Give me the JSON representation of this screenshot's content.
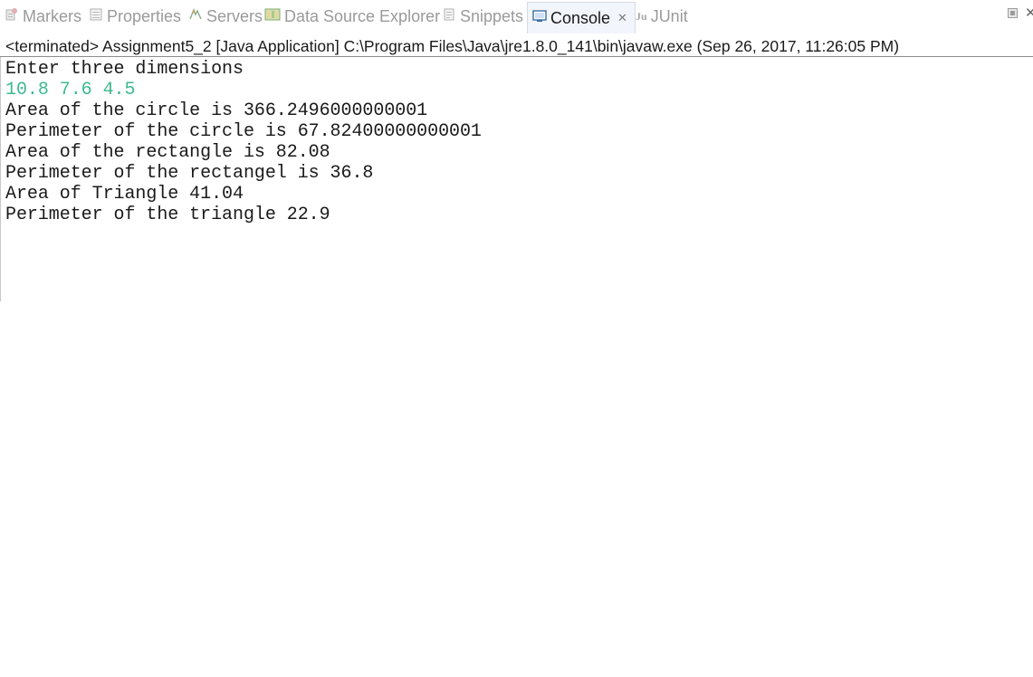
{
  "tabs": [
    {
      "label": "Markers",
      "icon": "markers-icon",
      "active": false
    },
    {
      "label": "Properties",
      "icon": "properties-icon",
      "active": false
    },
    {
      "label": "Servers",
      "icon": "servers-icon",
      "active": false
    },
    {
      "label": "Data Source Explorer",
      "icon": "data-source-explorer-icon",
      "active": false
    },
    {
      "label": "Snippets",
      "icon": "snippets-icon",
      "active": false
    },
    {
      "label": "Console",
      "icon": "console-icon",
      "active": true
    },
    {
      "label": "JUnit",
      "icon": "junit-icon",
      "active": false
    }
  ],
  "console": {
    "process_status": "<terminated> Assignment5_2 [Java Application] C:\\Program Files\\Java\\jre1.8.0_141\\bin\\javaw.exe (Sep 26, 2017, 11:26:05 PM)",
    "lines": [
      {
        "text": "Enter three dimensions",
        "kind": "output"
      },
      {
        "text": "10.8 7.6 4.5",
        "kind": "input"
      },
      {
        "text": "Area of the circle is 366.2496000000001",
        "kind": "output"
      },
      {
        "text": "Perimeter of the circle is 67.82400000000001",
        "kind": "output"
      },
      {
        "text": "Area of the rectangle is 82.08",
        "kind": "output"
      },
      {
        "text": "Perimeter of the rectangel is 36.8",
        "kind": "output"
      },
      {
        "text": "Area of Triangle 41.04",
        "kind": "output"
      },
      {
        "text": "Perimeter of the triangle 22.9",
        "kind": "output"
      }
    ]
  },
  "colors": {
    "input_text": "#3cb891",
    "output_text": "#1a1a1a",
    "inactive_tab_text": "#9a9a9a",
    "active_tab_bg": "#f2f5fb"
  }
}
